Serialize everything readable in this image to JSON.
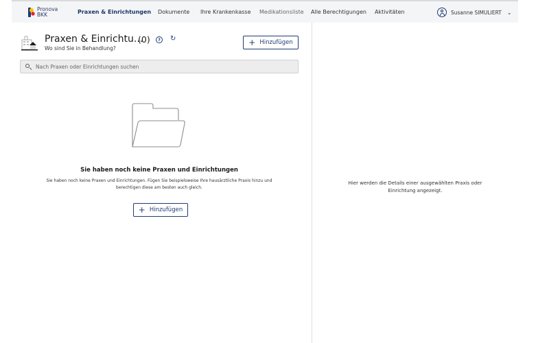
{
  "brand": {
    "line1": "Pronova",
    "line2": "BKK",
    "colors": {
      "yellow": "#f5c400",
      "red": "#e2232a",
      "blue": "#1f3b73"
    }
  },
  "nav": {
    "items": [
      {
        "label": "Praxen & Einrichtungen",
        "active": true
      },
      {
        "label": "Dokumente"
      },
      {
        "label": "Ihre Krankenkasse"
      },
      {
        "label": "Medikationsliste"
      },
      {
        "label": "Alle Berechtigungen"
      },
      {
        "label": "Aktivitäten"
      }
    ],
    "user": {
      "name": "Susanne SIMULIERT",
      "icon": "user-circle-icon",
      "chevron": "⌄"
    }
  },
  "page": {
    "title": "Praxen & Einrichtu...",
    "count": "(0)",
    "subtitle": "Wo sind Sie in Behandlung?",
    "help": "?",
    "refresh": "↻",
    "add_label": "Hinzufügen",
    "add_icon": "+"
  },
  "search": {
    "placeholder": "Nach Praxen oder Einrichtungen suchen",
    "value": ""
  },
  "empty": {
    "title": "Sie haben noch keine Praxen und Einrichtungen",
    "description": "Sie haben noch keine Praxen und Einrichtungen. Fügen Sie beispielsweise Ihre hausärztliche Praxis hinzu und berechtigen diese am besten auch gleich.",
    "add_label": "Hinzufügen",
    "add_icon": "+"
  },
  "detail": {
    "message": "Hier werden die Details einer ausgewählten Praxis oder Einrichtung angezeigt."
  },
  "colors": {
    "accent": "#1f3b73",
    "topbar": "#f4f5f7",
    "search_bg": "#ededee"
  }
}
